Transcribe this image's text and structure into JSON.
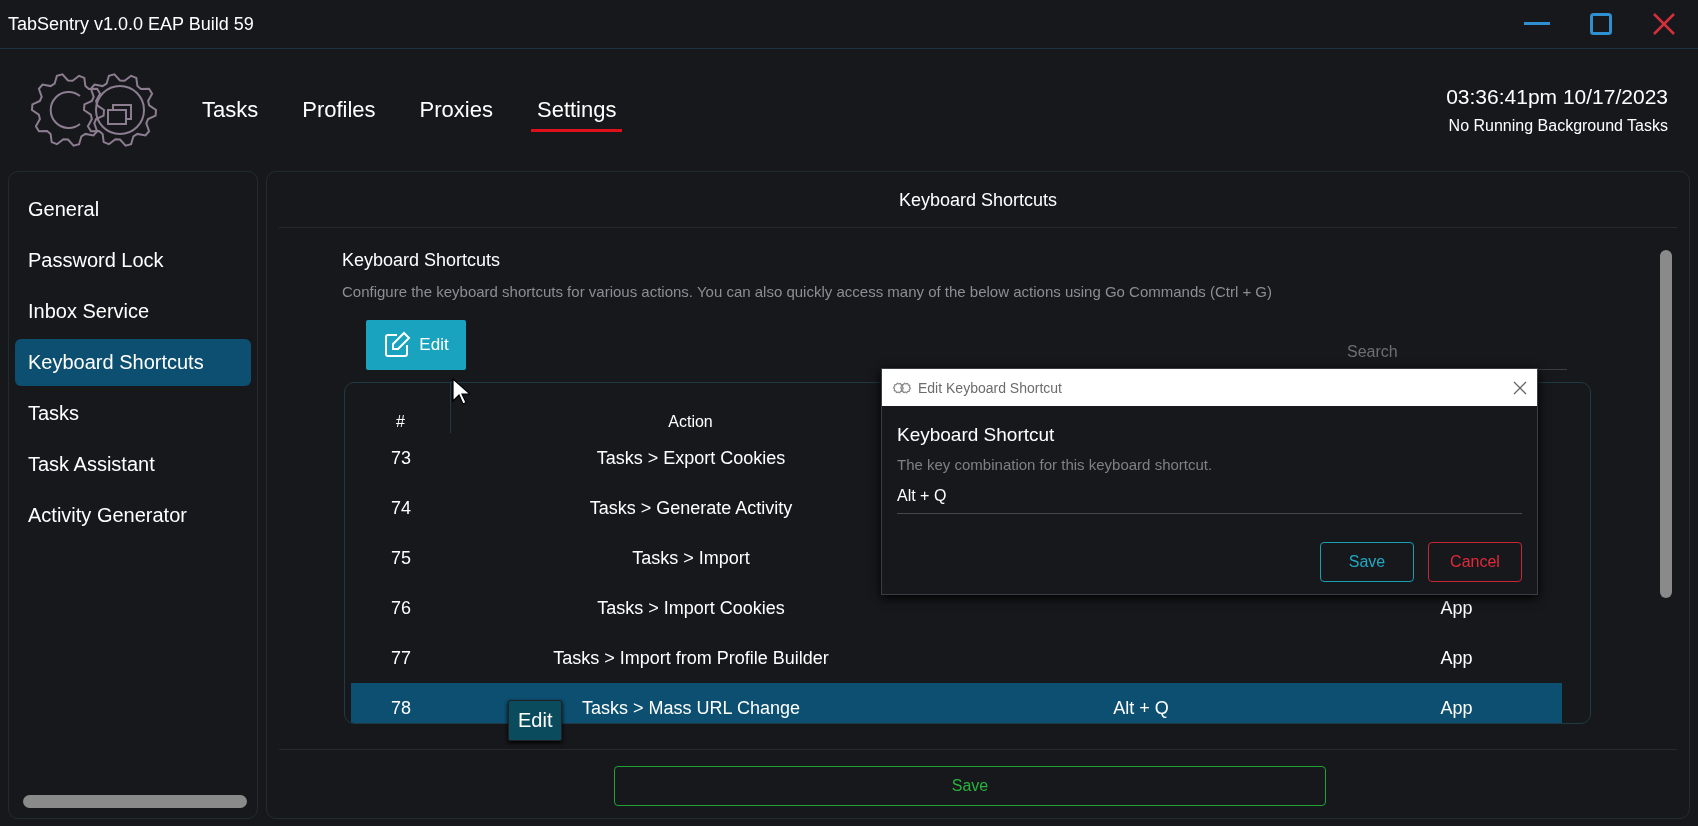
{
  "window": {
    "title": "TabSentry v1.0.0 EAP Build 59"
  },
  "nav": [
    {
      "label": "Tasks",
      "selected": false
    },
    {
      "label": "Profiles",
      "selected": false
    },
    {
      "label": "Proxies",
      "selected": false
    },
    {
      "label": "Settings",
      "selected": true
    }
  ],
  "clock": {
    "time": "03:36:41pm 10/17/2023",
    "status": "No Running Background Tasks"
  },
  "sidebar": {
    "items": [
      {
        "label": "General",
        "selected": false
      },
      {
        "label": "Password Lock",
        "selected": false
      },
      {
        "label": "Inbox Service",
        "selected": false
      },
      {
        "label": "Keyboard Shortcuts",
        "selected": true
      },
      {
        "label": "Tasks",
        "selected": false
      },
      {
        "label": "Task Assistant",
        "selected": false
      },
      {
        "label": "Activity Generator",
        "selected": false
      }
    ]
  },
  "panel": {
    "title": "Keyboard Shortcuts",
    "section_title": "Keyboard Shortcuts",
    "description": "Configure the keyboard shortcuts for various actions. You can also quickly access many of the below actions using Go Commands (Ctrl + G)",
    "edit_button": "Edit",
    "search": {
      "placeholder": "Search"
    },
    "table": {
      "columns": [
        "#",
        "Action"
      ],
      "rows": [
        {
          "number": "73",
          "action": "Tasks > Export Cookies",
          "selected": false
        },
        {
          "number": "74",
          "action": "Tasks > Generate Activity",
          "selected": false
        },
        {
          "number": "75",
          "action": "Tasks > Import",
          "selected": false
        },
        {
          "number": "76",
          "action": "Tasks > Import Cookies",
          "scope": "App",
          "selected": false
        },
        {
          "number": "77",
          "action": "Tasks > Import from Profile Builder",
          "scope": "App",
          "selected": false
        },
        {
          "number": "78",
          "action": "Tasks > Mass URL Change",
          "shortcut": "Alt + Q",
          "scope": "App",
          "selected": true
        }
      ]
    },
    "save_button": "Save"
  },
  "context_menu": {
    "items": [
      "Edit"
    ]
  },
  "dialog": {
    "title": "Edit Keyboard Shortcut",
    "field_label": "Keyboard Shortcut",
    "hint": "The key combination for this keyboard shortcut.",
    "value": "Alt + Q",
    "buttons": [
      {
        "label": "Save",
        "kind": "primary"
      },
      {
        "label": "Cancel",
        "kind": "danger"
      }
    ]
  }
}
